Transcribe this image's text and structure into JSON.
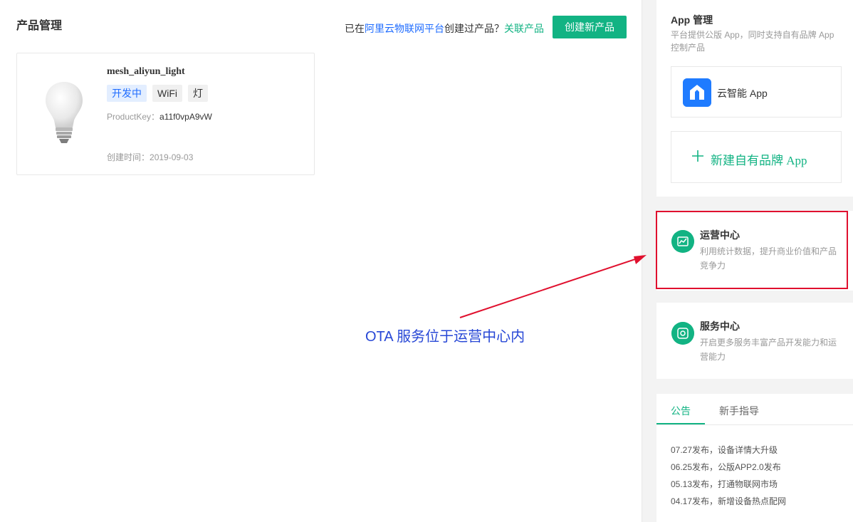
{
  "header": {
    "title": "产品管理",
    "prompt_prefix": "已在",
    "platform_link": "阿里云物联网平台",
    "prompt_suffix": "创建过产品？",
    "link_product": "关联产品",
    "create_button": "创建新产品"
  },
  "product": {
    "name": "mesh_aliyun_light",
    "tags": [
      "开发中",
      "WiFi",
      "灯"
    ],
    "product_key_label": "ProductKey：",
    "product_key": "a11f0vpA9vW",
    "created_label": "创建时间：",
    "created_date": "2019-09-03",
    "image_icon": "light-bulb-icon"
  },
  "annotation": {
    "text": "OTA 服务位于运营中心内",
    "arrow_color": "#e0102e",
    "frame_color": "#e0102e"
  },
  "app_panel": {
    "title": "App 管理",
    "description": "平台提供公版 App，同时支持自有品牌 App 控制产品",
    "app_name": "云智能 App",
    "new_app_label": "新建自有品牌 App"
  },
  "ops_center": {
    "title": "运营中心",
    "description": "利用统计数据，提升商业价值和产品竞争力",
    "icon": "chart-icon"
  },
  "service_center": {
    "title": "服务中心",
    "description": "开启更多服务丰富产品开发能力和运营能力",
    "icon": "service-icon"
  },
  "notices": {
    "tabs": [
      "公告",
      "新手指导"
    ],
    "items": [
      "07.27发布，设备详情大升级",
      "06.25发布，公版APP2.0发布",
      "05.13发布，打通物联网市场",
      "04.17发布，新增设备热点配网"
    ]
  },
  "colors": {
    "accent": "#12b383",
    "link": "#1f6cff",
    "annotation_text": "#2747d6"
  }
}
